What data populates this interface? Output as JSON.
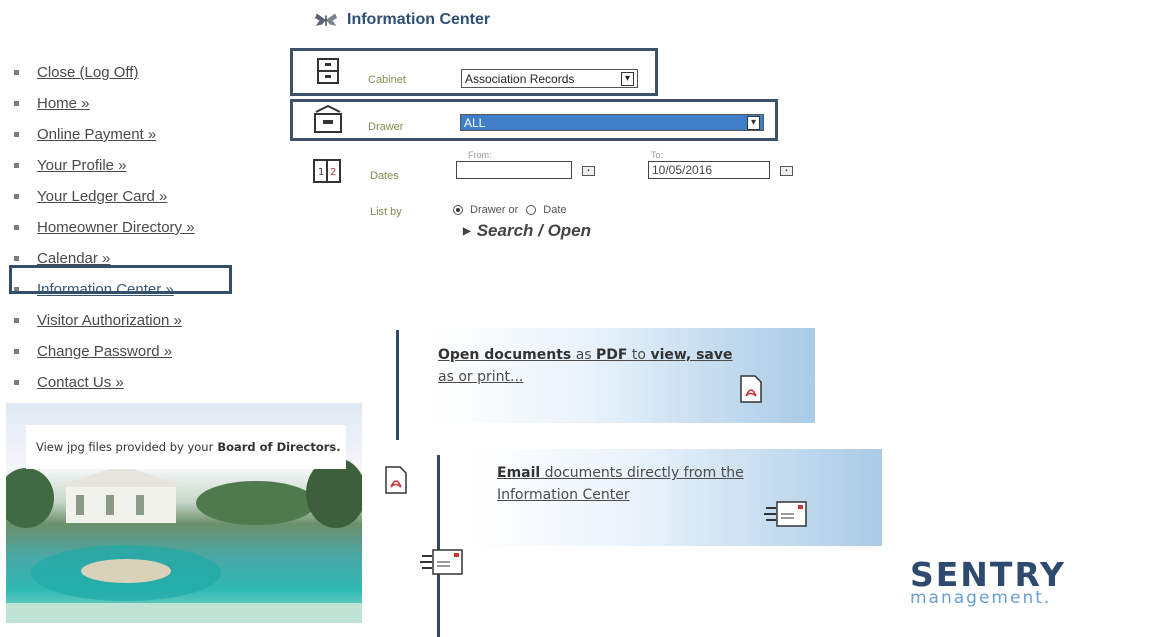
{
  "header": {
    "title": "Information Center",
    "icon": "butterfly-icon"
  },
  "nav": {
    "items": [
      {
        "label": "Close (Log Off)"
      },
      {
        "label": "Home »"
      },
      {
        "label": "Online Payment »"
      },
      {
        "label": "Your Profile »"
      },
      {
        "label": "Your Ledger Card »"
      },
      {
        "label": "Homeowner Directory »"
      },
      {
        "label": "Calendar »"
      },
      {
        "label": "Information Center »"
      },
      {
        "label": "Visitor Authorization »"
      },
      {
        "label": "Change Password »"
      },
      {
        "label": "Contact Us »"
      }
    ],
    "active_index": 7
  },
  "form": {
    "cabinet": {
      "label": "Cabinet",
      "value": "Association Records"
    },
    "drawer": {
      "label": "Drawer",
      "value": "ALL"
    },
    "dates": {
      "label": "Dates",
      "from_label": "From:",
      "from_value": "",
      "to_label": "To:",
      "to_value": "10/05/2016"
    },
    "list_by": {
      "label": "List by",
      "option_drawer": "Drawer or",
      "option_date": "Date",
      "selected": "Drawer"
    },
    "search_label": "Search / Open"
  },
  "callouts": {
    "pdf": {
      "strong1": "Open documents",
      "text1": " as ",
      "strong2": "PDF",
      "text2": " to ",
      "strong3": "view, save",
      "line2": "as or print..."
    },
    "email": {
      "strong": "Email",
      "text1": "  documents directly from the",
      "line2": "Information Center"
    }
  },
  "photo": {
    "caption_text": "View jpg files  provided by your",
    "caption_bold": "Board of Directors."
  },
  "logo": {
    "line1": "SENTRY",
    "line2": "management."
  },
  "colors": {
    "accent": "#2f4f74",
    "highlight_border": "#344f6b",
    "drawer_select": "#3f7fc9",
    "logo": "#2e4a6e"
  }
}
